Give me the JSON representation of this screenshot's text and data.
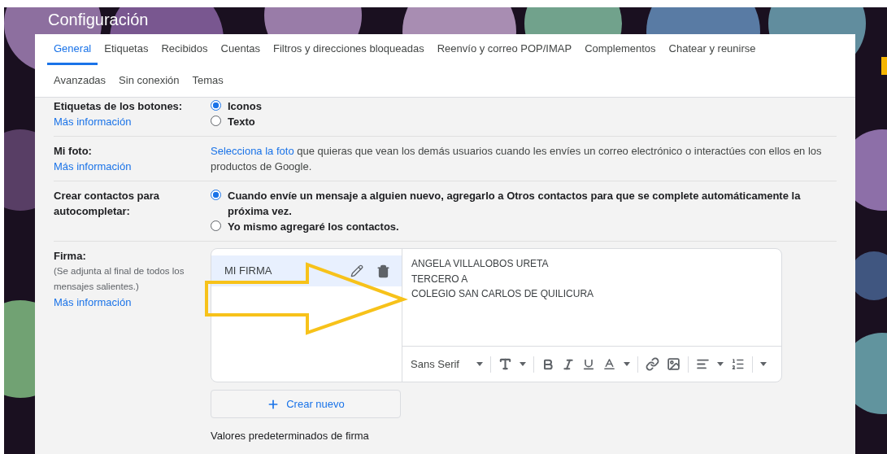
{
  "page_title": "Configuración",
  "tabs": [
    {
      "label": "General",
      "selected": true
    },
    {
      "label": "Etiquetas",
      "selected": false
    },
    {
      "label": "Recibidos",
      "selected": false
    },
    {
      "label": "Cuentas",
      "selected": false
    },
    {
      "label": "Filtros y direcciones bloqueadas",
      "selected": false
    },
    {
      "label": "Reenvío y correo POP/IMAP",
      "selected": false
    },
    {
      "label": "Complementos",
      "selected": false
    },
    {
      "label": "Chatear y reunirse",
      "selected": false
    },
    {
      "label": "Avanzadas",
      "selected": false
    },
    {
      "label": "Sin conexión",
      "selected": false
    },
    {
      "label": "Temas",
      "selected": false
    }
  ],
  "settings": [
    {
      "kind": "radio",
      "label": "Etiquetas de los botones:",
      "link": "Más información",
      "options": [
        {
          "label": "Iconos",
          "selected": true
        },
        {
          "label": "Texto",
          "selected": false
        }
      ]
    },
    {
      "kind": "text",
      "label": "Mi foto:",
      "link": "Más información",
      "value_link": "Selecciona la foto",
      "value": "que quieras que vean los demás usuarios cuando les envíes un correo electrónico o interactúes con ellos en los productos de Google."
    },
    {
      "kind": "radio",
      "label": "Crear contactos para autocompletar:",
      "options": [
        {
          "label": "Cuando envíe un mensaje a alguien nuevo, agregarlo a Otros contactos para que se complete automáticamente la próxima vez.",
          "selected": true
        },
        {
          "label": "Yo mismo agregaré los contactos.",
          "selected": false
        }
      ]
    },
    {
      "kind": "signature",
      "label": "Firma:",
      "note": "(Se adjunta al final de todos los mensajes salientes.)",
      "link": "Más información",
      "signatures": [
        {
          "name": "MI FIRMA",
          "selected": true
        }
      ],
      "editor_lines": [
        "ANGELA VILLALOBOS URETA",
        "TERCERO A",
        "COLEGIO SAN CARLOS DE QUILICURA"
      ],
      "font": "Sans Serif",
      "create_button": "Crear nuevo"
    }
  ],
  "next_section": "Valores predeterminados de firma"
}
